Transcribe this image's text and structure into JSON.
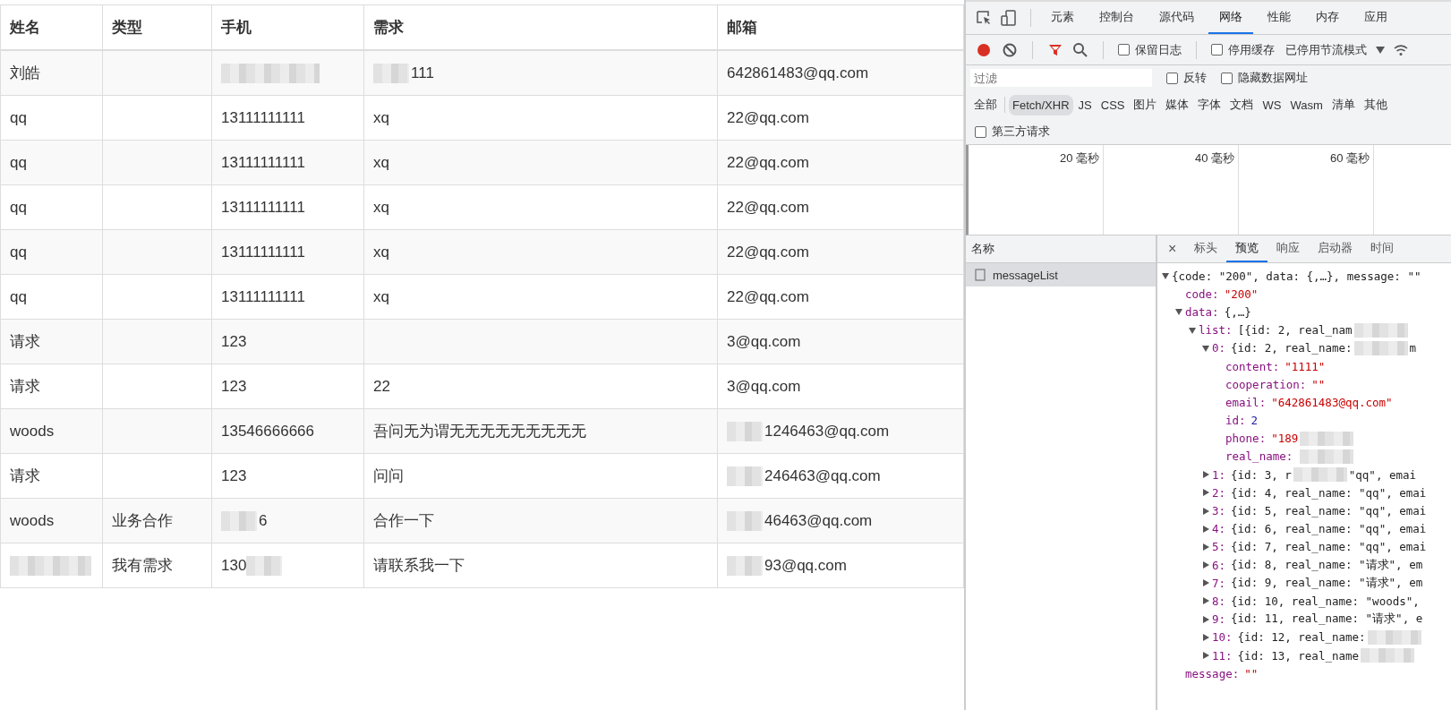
{
  "table": {
    "columns": [
      "姓名",
      "类型",
      "手机",
      "需求",
      "邮箱"
    ],
    "rows": [
      {
        "cells": [
          {
            "text": "刘皓"
          },
          {},
          {
            "masked_before": true
          },
          {
            "text": "111",
            "masked_before": true
          },
          {
            "text": "642861483@qq.com"
          }
        ]
      },
      {
        "cells": [
          {
            "text": "qq"
          },
          {},
          {
            "text": "13111111111"
          },
          {
            "text": "xq"
          },
          {
            "text": "22@qq.com"
          }
        ]
      },
      {
        "cells": [
          {
            "text": "qq"
          },
          {},
          {
            "text": "13111111111"
          },
          {
            "text": "xq"
          },
          {
            "text": "22@qq.com"
          }
        ]
      },
      {
        "cells": [
          {
            "text": "qq"
          },
          {},
          {
            "text": "13111111111"
          },
          {
            "text": "xq"
          },
          {
            "text": "22@qq.com"
          }
        ]
      },
      {
        "cells": [
          {
            "text": "qq"
          },
          {},
          {
            "text": "13111111111"
          },
          {
            "text": "xq"
          },
          {
            "text": "22@qq.com"
          }
        ]
      },
      {
        "cells": [
          {
            "text": "qq"
          },
          {},
          {
            "text": "13111111111"
          },
          {
            "text": "xq"
          },
          {
            "text": "22@qq.com"
          }
        ]
      },
      {
        "cells": [
          {
            "text": "请求"
          },
          {},
          {
            "text": "123"
          },
          {},
          {
            "text": "3@qq.com"
          }
        ]
      },
      {
        "cells": [
          {
            "text": "请求"
          },
          {},
          {
            "text": "123"
          },
          {
            "text": "22"
          },
          {
            "text": "3@qq.com"
          }
        ]
      },
      {
        "cells": [
          {
            "text": "woods"
          },
          {},
          {
            "text": "13546666666"
          },
          {
            "text": "吾问无为谓无无无无无无无无无"
          },
          {
            "text": "1246463@qq.com",
            "masked_before": true
          }
        ]
      },
      {
        "cells": [
          {
            "text": "请求"
          },
          {},
          {
            "text": "123"
          },
          {
            "text": "问问"
          },
          {
            "text": "246463@qq.com",
            "masked_before": true
          }
        ]
      },
      {
        "cells": [
          {
            "text": "woods"
          },
          {
            "text": "业务合作"
          },
          {
            "text": "6",
            "masked_before": true
          },
          {
            "text": "合作一下"
          },
          {
            "text": "46463@qq.com",
            "masked_before": true
          }
        ]
      },
      {
        "cells": [
          {
            "masked_before": true
          },
          {
            "text": "我有需求"
          },
          {
            "text": "130",
            "masked_after": true
          },
          {
            "text": "请联系我一下"
          },
          {
            "text": "93@qq.com",
            "masked_before": true
          }
        ]
      }
    ]
  },
  "devtools": {
    "tabs": [
      {
        "label": "元素",
        "selected": false
      },
      {
        "label": "控制台",
        "selected": false
      },
      {
        "label": "源代码",
        "selected": false
      },
      {
        "label": "网络",
        "selected": true
      },
      {
        "label": "性能",
        "selected": false
      },
      {
        "label": "内存",
        "selected": false
      },
      {
        "label": "应用",
        "selected": false
      }
    ],
    "toolbar": {
      "preserve_log": {
        "label": "保留日志",
        "checked": false
      },
      "disable_cache": {
        "label": "停用缓存",
        "checked": false
      },
      "throttling": "已停用节流模式"
    },
    "filter": {
      "placeholder": "过滤",
      "options": [
        {
          "label": "反转",
          "checked": false
        },
        {
          "label": "隐藏数据网址",
          "checked": false
        }
      ]
    },
    "types": [
      {
        "label": "全部",
        "selected": false
      },
      {
        "label": "Fetch/XHR",
        "selected": true
      },
      {
        "label": "JS",
        "selected": false
      },
      {
        "label": "CSS",
        "selected": false
      },
      {
        "label": "图片",
        "selected": false
      },
      {
        "label": "媒体",
        "selected": false
      },
      {
        "label": "字体",
        "selected": false
      },
      {
        "label": "文档",
        "selected": false
      },
      {
        "label": "WS",
        "selected": false
      },
      {
        "label": "Wasm",
        "selected": false
      },
      {
        "label": "清单",
        "selected": false
      },
      {
        "label": "其他",
        "selected": false
      }
    ],
    "third_party": {
      "label": "第三方请求",
      "checked": false
    },
    "timeline_ticks": [
      "20 毫秒",
      "40 毫秒",
      "60 毫秒"
    ],
    "requests": {
      "header": "名称",
      "items": [
        {
          "name": "messageList",
          "selected": true
        }
      ]
    },
    "detail_close": "×",
    "detail_tabs": [
      {
        "label": "标头",
        "selected": false
      },
      {
        "label": "预览",
        "selected": true
      },
      {
        "label": "响应",
        "selected": false
      },
      {
        "label": "启动器",
        "selected": false
      },
      {
        "label": "时间",
        "selected": false
      }
    ],
    "preview": [
      {
        "value": "{code: \"200\", data: {,…}, message: \"\"",
        "kind": "summary",
        "expanded": true,
        "children": [
          {
            "key": "code:",
            "value": "\"200\"",
            "kind": "string"
          },
          {
            "key": "data:",
            "value": "{,…}",
            "kind": "summary",
            "expanded": true,
            "children": [
              {
                "key": "list:",
                "value": "[{id: 2, real_nam",
                "kind": "summary",
                "masked": true,
                "expanded": true,
                "children": [
                  {
                    "key": "0:",
                    "value": "{id: 2, real_name:",
                    "kind": "summary",
                    "masked": true,
                    "tail": "m",
                    "expanded": true,
                    "children": [
                      {
                        "key": "content:",
                        "value": "\"1111\"",
                        "kind": "string"
                      },
                      {
                        "key": "cooperation:",
                        "value": "\"\"",
                        "kind": "string"
                      },
                      {
                        "key": "email:",
                        "value": "\"642861483@qq.com\"",
                        "kind": "string"
                      },
                      {
                        "key": "id:",
                        "value": "2",
                        "kind": "number"
                      },
                      {
                        "key": "phone:",
                        "value": "\"189",
                        "kind": "string",
                        "masked": true
                      },
                      {
                        "key": "real_name:",
                        "masked": true
                      }
                    ]
                  },
                  {
                    "key": "1:",
                    "value": "{id: 3, r",
                    "kind": "summary",
                    "masked": true,
                    "tail": "\"qq\", emai",
                    "expanded": false
                  },
                  {
                    "key": "2:",
                    "value": "{id: 4, real_name: \"qq\", emai",
                    "kind": "summary",
                    "expanded": false
                  },
                  {
                    "key": "3:",
                    "value": "{id: 5, real_name: \"qq\", emai",
                    "kind": "summary",
                    "expanded": false
                  },
                  {
                    "key": "4:",
                    "value": "{id: 6, real_name: \"qq\", emai",
                    "kind": "summary",
                    "expanded": false
                  },
                  {
                    "key": "5:",
                    "value": "{id: 7, real_name: \"qq\", emai",
                    "kind": "summary",
                    "expanded": false
                  },
                  {
                    "key": "6:",
                    "value": "{id: 8, real_name: \"请求\", em",
                    "kind": "summary",
                    "expanded": false
                  },
                  {
                    "key": "7:",
                    "value": "{id: 9, real_name: \"请求\", em",
                    "kind": "summary",
                    "expanded": false
                  },
                  {
                    "key": "8:",
                    "value": "{id: 10, real_name: \"woods\",",
                    "kind": "summary",
                    "expanded": false
                  },
                  {
                    "key": "9:",
                    "value": "{id: 11, real_name: \"请求\", e",
                    "kind": "summary",
                    "expanded": false
                  },
                  {
                    "key": "10:",
                    "value": "{id: 12, real_name:",
                    "kind": "summary",
                    "masked": true,
                    "expanded": false
                  },
                  {
                    "key": "11:",
                    "value": "{id: 13, real_name",
                    "kind": "summary",
                    "masked": true,
                    "expanded": false
                  }
                ]
              }
            ]
          },
          {
            "key": "message:",
            "value": "\"\"",
            "kind": "string"
          }
        ]
      }
    ]
  }
}
